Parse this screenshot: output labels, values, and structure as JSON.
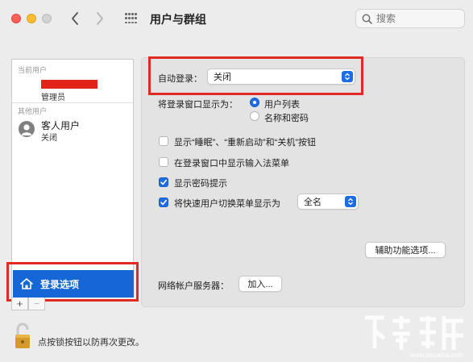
{
  "window": {
    "title": "用户与群组"
  },
  "search": {
    "placeholder": "搜索"
  },
  "sidebar": {
    "current_users_label": "当前用户",
    "admin_role": "管理员",
    "other_users_label": "其他用户",
    "guest": {
      "name": "客人用户",
      "status": "关闭"
    },
    "login_options": "登录选项",
    "add_button": "+",
    "remove_button": "−"
  },
  "panel": {
    "auto_login_label": "自动登录：",
    "auto_login_value": "关闭",
    "display_login_as_label": "将登录窗口显示为：",
    "radio_user_list": "用户列表",
    "radio_name_password": "名称和密码",
    "user_list_selected": true,
    "check_sleep_restart": "显示“睡眠”、“重新启动”和“关机”按钮",
    "check_sleep_restart_checked": false,
    "check_input_menu": "在登录窗口中显示输入法菜单",
    "check_input_menu_checked": false,
    "check_password_hint": "显示密码提示",
    "check_password_hint_checked": true,
    "check_fast_switch": "将快速用户切换菜单显示为",
    "check_fast_switch_checked": true,
    "fast_switch_value": "全名",
    "accessibility_button": "辅助功能选项...",
    "network_server_label": "网络帐户服务器：",
    "join_button": "加入..."
  },
  "lock": {
    "text": "点按锁按钮以防再次更改。"
  },
  "watermark": {
    "site": "www.xiazaiba.com"
  },
  "colors": {
    "accent": "#1d6ce0",
    "selection": "#1566d6",
    "highlight_box": "#e02a23"
  }
}
